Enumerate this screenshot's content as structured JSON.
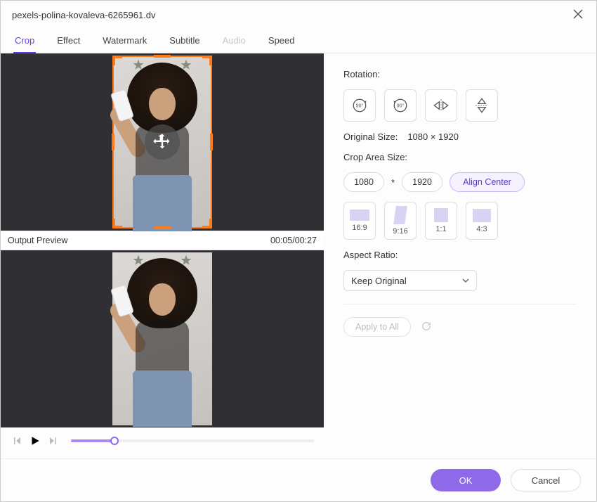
{
  "title": "pexels-polina-kovaleva-6265961.dv",
  "tabs": {
    "crop": "Crop",
    "effect": "Effect",
    "watermark": "Watermark",
    "subtitle": "Subtitle",
    "audio": "Audio",
    "speed": "Speed"
  },
  "preview": {
    "output_label": "Output Preview",
    "time": "00:05/00:27"
  },
  "rotation": {
    "label": "Rotation:"
  },
  "original_size": {
    "label": "Original Size:",
    "value": "1080 × 1920"
  },
  "crop_area": {
    "label": "Crop Area Size:",
    "width": "1080",
    "sep": "*",
    "height": "1920",
    "align_center": "Align Center"
  },
  "ratios": {
    "r16_9": "16:9",
    "r9_16": "9:16",
    "r1_1": "1:1",
    "r4_3": "4:3"
  },
  "aspect": {
    "label": "Aspect Ratio:",
    "value": "Keep Original"
  },
  "apply_all": "Apply to All",
  "footer": {
    "ok": "OK",
    "cancel": "Cancel"
  }
}
